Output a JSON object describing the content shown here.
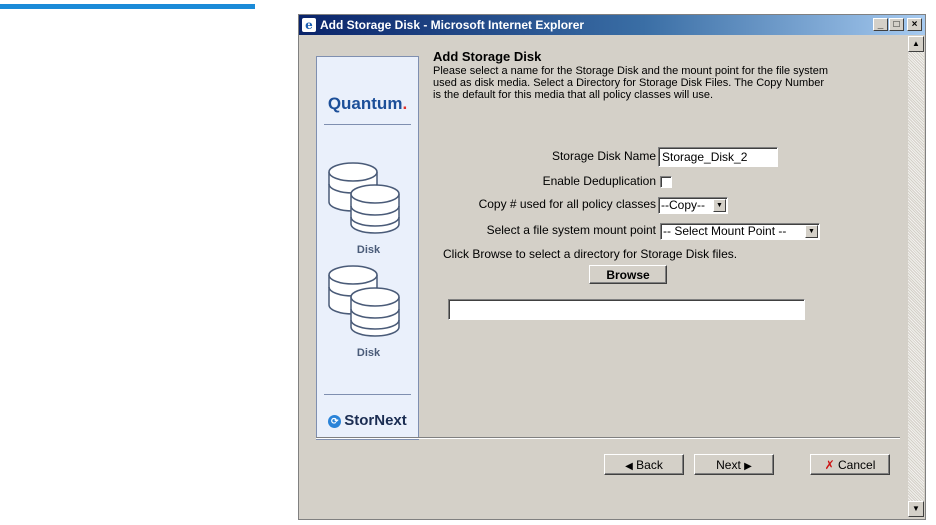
{
  "window": {
    "title": "Add Storage Disk - Microsoft Internet Explorer",
    "controls": {
      "minimize": "_",
      "maximize": "□",
      "close": "×"
    }
  },
  "sidebar": {
    "brand_top": "Quantum",
    "brand_top_dot": ".",
    "items": [
      {
        "label": "Disk",
        "icon": "disk-stack-icon"
      },
      {
        "label": "Disk",
        "icon": "disk-stack-icon"
      }
    ],
    "brand_bottom": "StorNext"
  },
  "form": {
    "heading": "Add Storage Disk",
    "intro": "Please select a name for the Storage Disk and the mount point for the file system used as disk media. Select a Directory for Storage Disk Files. The Copy Number is the default for this media that all policy classes will use.",
    "storage_disk_name": {
      "label": "Storage Disk Name",
      "value": "Storage_Disk_2"
    },
    "enable_dedup": {
      "label": "Enable Deduplication",
      "checked": false
    },
    "copy_number": {
      "label": "Copy # used for all policy classes",
      "selected": "--Copy--"
    },
    "mount_point": {
      "label": "Select a file system mount point",
      "selected": "-- Select Mount Point --"
    },
    "browse_hint": "Click Browse to select a directory for Storage Disk files.",
    "browse_label": "Browse",
    "directory_value": ""
  },
  "footer": {
    "back_label": "Back",
    "next_label": "Next",
    "cancel_label": "Cancel"
  },
  "colors": {
    "title_bar": "#0a246a",
    "window_face": "#d4d0c8",
    "sidebar_bg": "#eaf0fb",
    "quantum_blue": "#1c4f99",
    "cancel_red": "#cc1111"
  }
}
